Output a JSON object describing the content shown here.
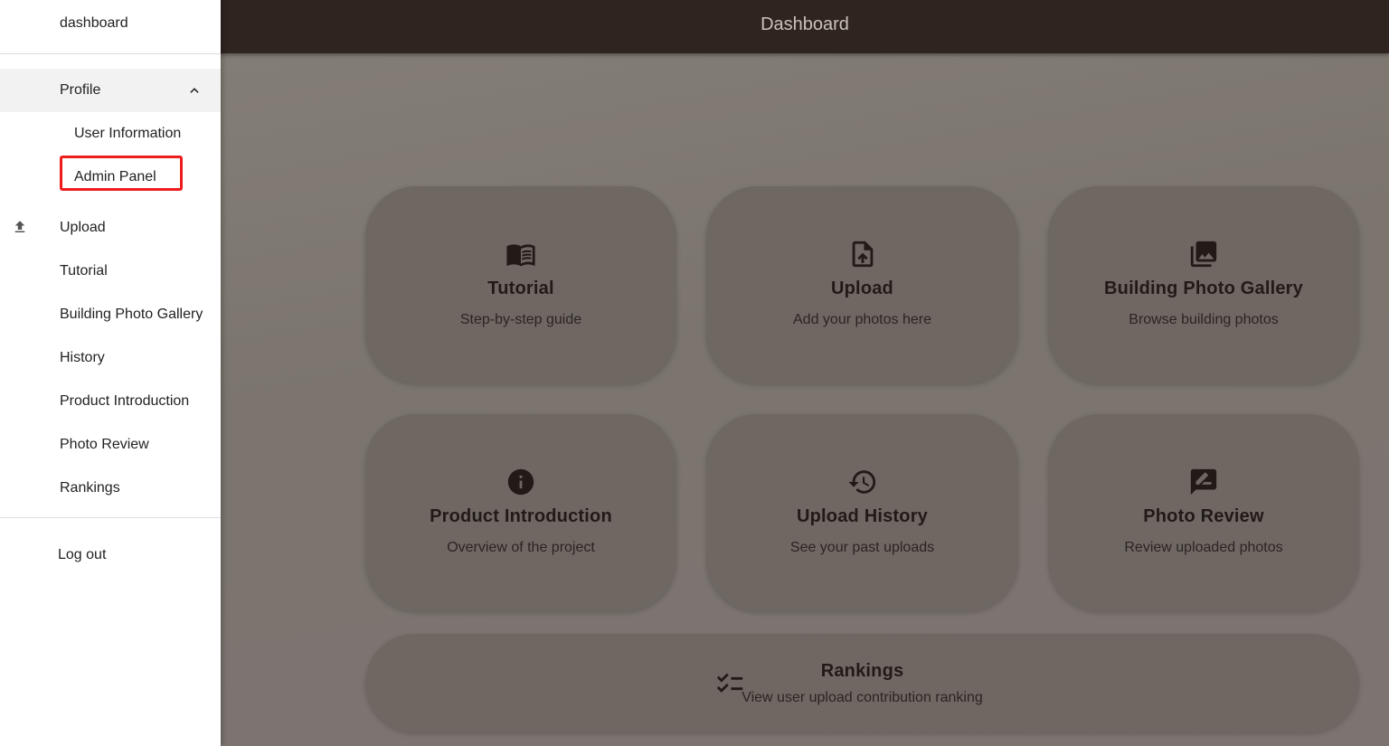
{
  "header": {
    "title": "Dashboard"
  },
  "sidebar": {
    "brand": "dashboard",
    "profile": {
      "label": "Profile",
      "expanded": true
    },
    "sub_items": [
      {
        "label": "User Information"
      },
      {
        "label": "Admin Panel",
        "highlighted": true
      }
    ],
    "items": [
      {
        "label": "Upload",
        "icon": "upload-icon"
      },
      {
        "label": "Tutorial"
      },
      {
        "label": "Building Photo Gallery"
      },
      {
        "label": "History"
      },
      {
        "label": "Product Introduction"
      },
      {
        "label": "Photo Review"
      },
      {
        "label": "Rankings"
      }
    ],
    "logout": "Log out"
  },
  "cards": [
    {
      "title": "Tutorial",
      "desc": "Step-by-step guide",
      "icon": "book-icon"
    },
    {
      "title": "Upload",
      "desc": "Add your photos here",
      "icon": "upload-file-icon"
    },
    {
      "title": "Building Photo Gallery",
      "desc": "Browse building photos",
      "icon": "photo-library-icon"
    },
    {
      "title": "Product Introduction",
      "desc": "Overview of the project",
      "icon": "info-icon"
    },
    {
      "title": "Upload History",
      "desc": "See your past uploads",
      "icon": "history-icon"
    },
    {
      "title": "Photo Review",
      "desc": "Review uploaded photos",
      "icon": "rate-review-icon"
    },
    {
      "title": "Rankings",
      "desc": "View user upload contribution ranking",
      "icon": "checklist-icon"
    }
  ],
  "colors": {
    "topbar": "#302420",
    "card": "#6e6762",
    "highlight": "#ee1c1c",
    "icon": "#221a17"
  }
}
